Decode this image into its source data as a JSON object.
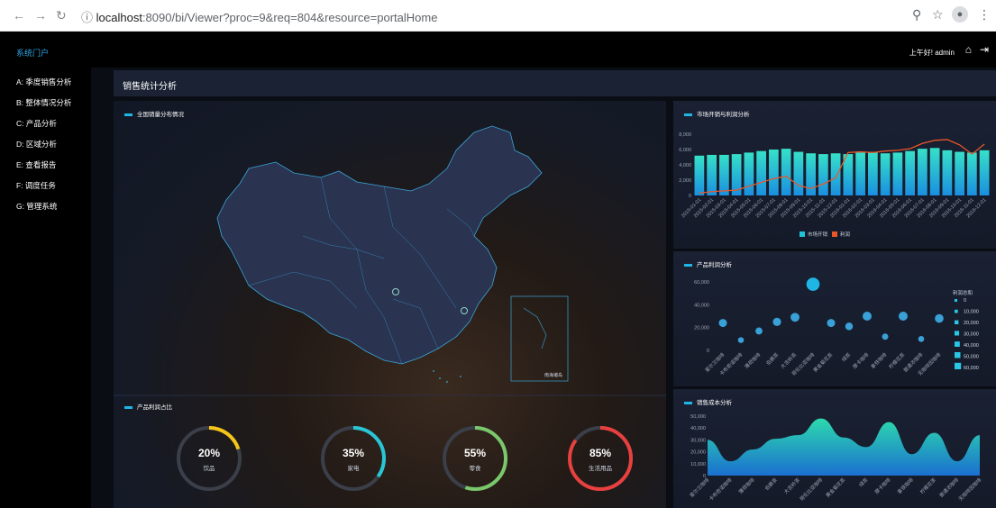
{
  "browser": {
    "url_host": "localhost",
    "url_rest": ":8090/bi/Viewer?proc=9&req=804&resource=portalHome"
  },
  "header": {
    "brand": "系统门户",
    "greeting": "上午好! admin"
  },
  "sidebar": {
    "items": [
      {
        "label": "A: 季度销售分析"
      },
      {
        "label": "B: 整体情况分析"
      },
      {
        "label": "C: 产品分析"
      },
      {
        "label": "D: 区域分析"
      },
      {
        "label": "E: 查看报告"
      },
      {
        "label": "F: 调度任务"
      },
      {
        "label": "G: 管理系统"
      }
    ]
  },
  "page": {
    "title": "销售统计分析"
  },
  "panels": {
    "map": {
      "title": "全国销量分布情况",
      "inset_label": "南海诸岛"
    },
    "donuts": {
      "title": "产品利润占比",
      "items": [
        {
          "pct": "20%",
          "label": "饮品",
          "value": 0.2,
          "color": "#f5c518"
        },
        {
          "pct": "35%",
          "label": "家电",
          "value": 0.35,
          "color": "#29c7d6"
        },
        {
          "pct": "55%",
          "label": "零食",
          "value": 0.55,
          "color": "#7ac86b"
        },
        {
          "pct": "85%",
          "label": "生活用品",
          "value": 0.85,
          "color": "#e8403e"
        }
      ]
    },
    "market": {
      "title": "市场开销与利润分析"
    },
    "profit": {
      "title": "产品利润分析",
      "legend_title": "利润总和"
    },
    "cost": {
      "title": "销售成本分析"
    }
  },
  "chart_data": [
    {
      "type": "bar",
      "title": "市场开销与利润分析",
      "ylim": [
        0,
        8000
      ],
      "yticks": [
        "8,000",
        "6,000",
        "4,000",
        "2,000",
        "0"
      ],
      "categories": [
        "2015-01-01",
        "2015-02-01",
        "2015-03-01",
        "2015-04-01",
        "2015-05-01",
        "2015-06-01",
        "2015-07-01",
        "2015-08-01",
        "2015-09-01",
        "2015-10-01",
        "2015-11-01",
        "2015-12-01",
        "2016-01-01",
        "2016-02-01",
        "2016-03-01",
        "2016-04-01",
        "2016-05-01",
        "2016-06-01",
        "2016-07-01",
        "2016-08-01",
        "2016-09-01",
        "2016-10-01",
        "2016-11-01",
        "2016-12-01"
      ],
      "series": [
        {
          "name": "市场开销",
          "type": "bar",
          "color": "#1fc3d8",
          "values": [
            5200,
            5300,
            5300,
            5400,
            5600,
            5800,
            6000,
            6100,
            5700,
            5500,
            5400,
            5500,
            5400,
            5600,
            5700,
            5500,
            5600,
            5800,
            6100,
            6200,
            5900,
            5700,
            5600,
            5900
          ]
        },
        {
          "name": "利润",
          "type": "line",
          "color": "#e8572a",
          "values": [
            300,
            500,
            600,
            700,
            1200,
            1700,
            2200,
            2500,
            1300,
            900,
            1500,
            2300,
            5600,
            5700,
            5600,
            5800,
            5900,
            6100,
            6800,
            7200,
            7300,
            6600,
            5400,
            6700
          ]
        }
      ]
    },
    {
      "type": "scatter",
      "title": "产品利润分析",
      "ylim": [
        0,
        60000
      ],
      "yticks": [
        "60,000",
        "40,000",
        "20,000",
        "0"
      ],
      "categories": [
        "爱尔兰咖啡",
        "卡布奇诺咖啡",
        "薄荷咖啡",
        "伯爵茶",
        "大吉岭茶",
        "哥伦比亚咖啡",
        "黄金菊花茶",
        "绿茶",
        "摩卡咖啡",
        "拿铁咖啡",
        "柠檬花茶",
        "普通浓咖啡",
        "无咖啡因咖啡"
      ],
      "values": [
        24000,
        9000,
        17000,
        25000,
        29000,
        58000,
        24000,
        21000,
        30000,
        12000,
        30000,
        10000,
        28000
      ],
      "legend": [
        "0",
        "10,000",
        "20,000",
        "30,000",
        "40,000",
        "50,000",
        "60,000"
      ]
    },
    {
      "type": "area",
      "title": "销售成本分析",
      "ylim": [
        0,
        50000
      ],
      "yticks": [
        "50,000",
        "40,000",
        "30,000",
        "20,000",
        "10,000",
        "0"
      ],
      "categories": [
        "爱尔兰咖啡",
        "卡布奇诺咖啡",
        "薄荷咖啡",
        "伯爵茶",
        "大吉岭茶",
        "哥伦比亚咖啡",
        "黄金菊花茶",
        "绿茶",
        "摩卡咖啡",
        "拿铁咖啡",
        "柠檬花茶",
        "普通浓咖啡",
        "无咖啡因咖啡"
      ],
      "values": [
        30000,
        12000,
        22000,
        31000,
        34000,
        48000,
        32000,
        24000,
        45000,
        18000,
        36000,
        12000,
        34000
      ]
    }
  ]
}
